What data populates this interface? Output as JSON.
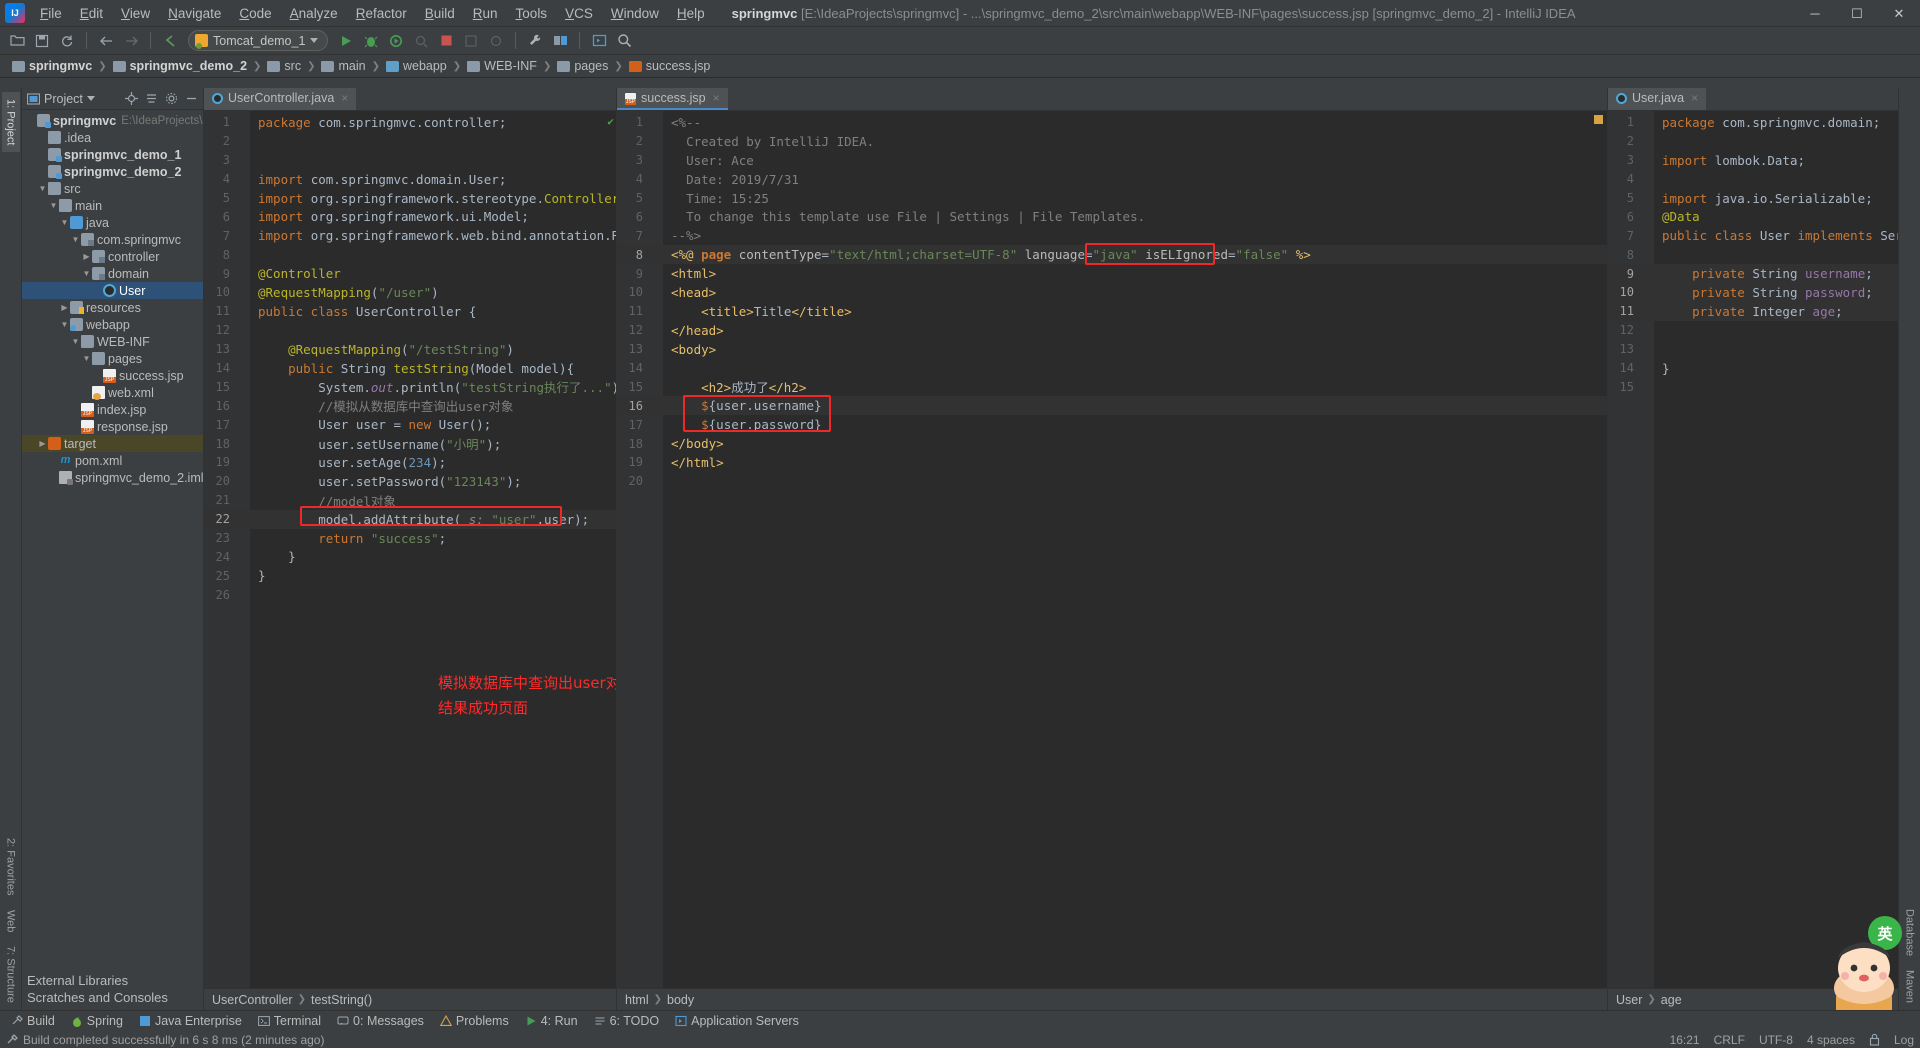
{
  "window": {
    "project_name": "springmvc",
    "title_path": "[E:\\IdeaProjects\\springmvc] - ...\\springmvc_demo_2\\src\\main\\webapp\\WEB-INF\\pages\\success.jsp [springmvc_demo_2] - IntelliJ IDEA",
    "minimize": "─",
    "maximize": "☐",
    "close": "✕"
  },
  "menubar": [
    {
      "label": "File"
    },
    {
      "label": "Edit"
    },
    {
      "label": "View"
    },
    {
      "label": "Navigate"
    },
    {
      "label": "Code"
    },
    {
      "label": "Analyze"
    },
    {
      "label": "Refactor"
    },
    {
      "label": "Build"
    },
    {
      "label": "Run"
    },
    {
      "label": "Tools"
    },
    {
      "label": "VCS"
    },
    {
      "label": "Window"
    },
    {
      "label": "Help"
    }
  ],
  "toolbar": {
    "run_config": "Tomcat_demo_1",
    "icons": [
      "open-folder-icon",
      "save-all-icon",
      "sync-icon",
      "back-arrow-icon",
      "forward-arrow-icon",
      "undo-icon",
      "run-icon",
      "debug-icon",
      "run-with-coverage-icon",
      "profile-icon",
      "stop-icon",
      "step-over-icon",
      "step-into-icon",
      "settings-wrench-icon",
      "project-structure-icon",
      "app-servers-icon",
      "search-everywhere-icon"
    ]
  },
  "breadcrumb": [
    {
      "label": "springmvc",
      "icon": "module-icon",
      "bold": true
    },
    {
      "label": "springmvc_demo_2",
      "icon": "module-icon",
      "bold": true
    },
    {
      "label": "src",
      "icon": "folder-icon",
      "bold": false
    },
    {
      "label": "main",
      "icon": "folder-icon",
      "bold": false
    },
    {
      "label": "webapp",
      "icon": "folder-web-icon",
      "bold": false
    },
    {
      "label": "WEB-INF",
      "icon": "folder-icon",
      "bold": false
    },
    {
      "label": "pages",
      "icon": "folder-icon",
      "bold": false
    },
    {
      "label": "success.jsp",
      "icon": "jsp-file-icon",
      "bold": false
    }
  ],
  "left_rail": [
    {
      "label": "1: Project",
      "icon": "project-icon",
      "active": true
    },
    {
      "label": "2: Favorites",
      "icon": "star-icon",
      "active": false
    },
    {
      "label": "Web",
      "icon": "web-icon",
      "active": false
    },
    {
      "label": "7: Structure",
      "icon": "structure-icon",
      "active": false
    }
  ],
  "right_rail": [
    {
      "label": "Database",
      "icon": "database-icon"
    },
    {
      "label": "Maven",
      "icon": "maven-icon"
    }
  ],
  "project_panel": {
    "title": "Project",
    "icons": [
      "locate-icon",
      "collapse-all-icon",
      "settings-gear-icon",
      "hide-icon"
    ],
    "tree": [
      {
        "indent": 0,
        "arrow": "",
        "icon": "module-icon",
        "label": "springmvc",
        "bold": true,
        "path": "E:\\IdeaProjects\\springmvc",
        "state": ""
      },
      {
        "indent": 1,
        "arrow": "",
        "icon": "folder-icon",
        "label": ".idea",
        "bold": false,
        "path": "",
        "state": ""
      },
      {
        "indent": 1,
        "arrow": "",
        "icon": "module-icon",
        "label": "springmvc_demo_1",
        "bold": true,
        "path": "",
        "state": ""
      },
      {
        "indent": 1,
        "arrow": "",
        "icon": "module-icon",
        "label": "springmvc_demo_2",
        "bold": true,
        "path": "",
        "state": ""
      },
      {
        "indent": 1,
        "arrow": "down",
        "icon": "folder-icon",
        "label": "src",
        "bold": false,
        "path": "",
        "state": ""
      },
      {
        "indent": 2,
        "arrow": "down",
        "icon": "folder-icon",
        "label": "main",
        "bold": false,
        "path": "",
        "state": ""
      },
      {
        "indent": 3,
        "arrow": "down",
        "icon": "folder-src-icon",
        "label": "java",
        "bold": false,
        "path": "",
        "state": ""
      },
      {
        "indent": 4,
        "arrow": "down",
        "icon": "folder-pkg-icon",
        "label": "com.springmvc",
        "bold": false,
        "path": "",
        "state": ""
      },
      {
        "indent": 5,
        "arrow": "right",
        "icon": "folder-pkg-icon",
        "label": "controller",
        "bold": false,
        "path": "",
        "state": ""
      },
      {
        "indent": 5,
        "arrow": "down",
        "icon": "folder-pkg-icon",
        "label": "domain",
        "bold": false,
        "path": "",
        "state": ""
      },
      {
        "indent": 6,
        "arrow": "",
        "icon": "class-icon",
        "label": "User",
        "bold": false,
        "path": "",
        "state": "sel"
      },
      {
        "indent": 3,
        "arrow": "right",
        "icon": "folder-res-icon",
        "label": "resources",
        "bold": false,
        "path": "",
        "state": ""
      },
      {
        "indent": 3,
        "arrow": "down",
        "icon": "folder-web-icon",
        "label": "webapp",
        "bold": false,
        "path": "",
        "state": ""
      },
      {
        "indent": 4,
        "arrow": "down",
        "icon": "folder-icon",
        "label": "WEB-INF",
        "bold": false,
        "path": "",
        "state": ""
      },
      {
        "indent": 5,
        "arrow": "down",
        "icon": "folder-icon",
        "label": "pages",
        "bold": false,
        "path": "",
        "state": ""
      },
      {
        "indent": 6,
        "arrow": "",
        "icon": "jsp-file-icon",
        "label": "success.jsp",
        "bold": false,
        "path": "",
        "state": ""
      },
      {
        "indent": 5,
        "arrow": "",
        "icon": "xml-file-icon",
        "label": "web.xml",
        "bold": false,
        "path": "",
        "state": ""
      },
      {
        "indent": 4,
        "arrow": "",
        "icon": "jsp-file-icon",
        "label": "index.jsp",
        "bold": false,
        "path": "",
        "state": ""
      },
      {
        "indent": 4,
        "arrow": "",
        "icon": "jsp-file-icon",
        "label": "response.jsp",
        "bold": false,
        "path": "",
        "state": ""
      },
      {
        "indent": 1,
        "arrow": "right",
        "icon": "folder-target-icon",
        "label": "target",
        "bold": false,
        "path": "",
        "state": "tgt"
      },
      {
        "indent": 2,
        "arrow": "",
        "icon": "maven-icon",
        "label": "pom.xml",
        "bold": false,
        "path": "",
        "state": ""
      },
      {
        "indent": 2,
        "arrow": "",
        "icon": "iml-icon",
        "label": "springmvc_demo_2.iml",
        "bold": false,
        "path": "",
        "state": ""
      }
    ],
    "external_libraries": "External Libraries",
    "scratches": "Scratches and Consoles"
  },
  "editor_left": {
    "tab": {
      "label": "UserController.java",
      "icon": "java-class-icon",
      "close": "×"
    },
    "breadcrumb": [
      "UserController",
      "testString()"
    ],
    "marker": "check-ok-icon",
    "lines": [
      {
        "n": 1,
        "html": "<span class='kw'>package</span> <span class='white'>com.springmvc.controller</span><span class='white'>;</span>"
      },
      {
        "n": 2,
        "html": ""
      },
      {
        "n": 3,
        "html": ""
      },
      {
        "n": 4,
        "html": "<span class='kw'>import</span> <span class='white'>com.springmvc.domain.User;</span>"
      },
      {
        "n": 5,
        "html": "<span class='kw'>import</span> <span class='white'>org.springframework.stereotype.</span><span class='ann'>Controller</span><span class='white'>;</span>"
      },
      {
        "n": 6,
        "html": "<span class='kw'>import</span> <span class='white'>org.springframework.ui.Model;</span>"
      },
      {
        "n": 7,
        "html": "<span class='kw'>import</span> <span class='white'>org.springframework.web.bind.annotation.RequestM</span>"
      },
      {
        "n": 8,
        "html": ""
      },
      {
        "n": 9,
        "html": "<span class='ann'>@Controller</span>"
      },
      {
        "n": 10,
        "html": "<span class='ann'>@RequestMapping</span><span class='white'>(</span><span class='str'>\"/user\"</span><span class='white'>)</span>"
      },
      {
        "n": 11,
        "html": "<span class='kw'>public class</span> <span class='white'>UserController {</span>"
      },
      {
        "n": 12,
        "html": ""
      },
      {
        "n": 13,
        "html": "    <span class='ann'>@RequestMapping</span><span class='white'>(</span><span class='str'>\"/testString\"</span><span class='white'>)</span>"
      },
      {
        "n": 14,
        "html": "    <span class='kw'>public</span> <span class='white'>String </span><span class='ann'>testString</span><span class='white'>(Model model){</span>"
      },
      {
        "n": 15,
        "html": "        <span class='white'>System.</span><span class='fld' style='font-style:italic'>out</span><span class='white'>.println(</span><span class='str'>\"testString执行了...\"</span><span class='white'>);</span>"
      },
      {
        "n": 16,
        "html": "        <span class='cmt'>//模拟从数据库中查询出user对象</span>"
      },
      {
        "n": 17,
        "html": "        <span class='white'>User user = </span><span class='kw'>new</span><span class='white'> User();</span>"
      },
      {
        "n": 18,
        "html": "        <span class='white'>user.setUsername(</span><span class='str'>\"小明\"</span><span class='white'>);</span>"
      },
      {
        "n": 19,
        "html": "        <span class='white'>user.setAge(</span><span class='num'>234</span><span class='white'>);</span>"
      },
      {
        "n": 20,
        "html": "        <span class='white'>user.setPassword(</span><span class='str'>\"123143\"</span><span class='white'>);</span>"
      },
      {
        "n": 21,
        "html": "        <span class='cmt'>//model对象</span>"
      },
      {
        "n": 22,
        "html": "        <span class='white'>model.addAttribute(</span> <span class='param'>s:</span> <span class='str'>\"user\"</span><span class='white'>,user);</span>"
      },
      {
        "n": 23,
        "html": "        <span class='kw'>return</span> <span class='str'>\"success\"</span><span class='white'>;</span>"
      },
      {
        "n": 24,
        "html": "    <span class='white'>}</span>"
      },
      {
        "n": 25,
        "html": "<span class='white'>}</span>"
      },
      {
        "n": 26,
        "html": ""
      }
    ],
    "annotation": "模拟数据库中查询出user对象，并把所取到的值转发到\n结果成功页面"
  },
  "editor_mid": {
    "tab": {
      "label": "success.jsp",
      "icon": "jsp-file-icon",
      "close": "×"
    },
    "breadcrumb": [
      "html",
      "body"
    ],
    "lines": [
      {
        "n": 1,
        "html": "<span class='cmt'>&lt;%--</span>"
      },
      {
        "n": 2,
        "html": "  <span class='cmt'>Created by IntelliJ IDEA.</span>"
      },
      {
        "n": 3,
        "html": "  <span class='cmt'>User: Ace</span>"
      },
      {
        "n": 4,
        "html": "  <span class='cmt'>Date: 2019/7/31</span>"
      },
      {
        "n": 5,
        "html": "  <span class='cmt'>Time: 15:25</span>"
      },
      {
        "n": 6,
        "html": "  <span class='cmt'>To change this template use File | Settings | File Templates.</span>"
      },
      {
        "n": 7,
        "html": "<span class='cmt'>--%&gt;</span>"
      },
      {
        "n": 8,
        "html": "<span class='tag'>&lt;%@</span> <span class='jspk'>page</span> <span class='attr'>contentType</span><span class='white'>=</span><span class='str'>\"text/html;charset=UTF-8\"</span> <span class='attr'>language</span><span class='white'>=</span><span class='str'>\"java\"</span> <span class='attr'>isELIgnored</span><span class='white'>=</span><span class='str'>\"false\"</span> <span class='tag'>%&gt;</span>"
      },
      {
        "n": 9,
        "html": "<span class='tag'>&lt;html&gt;</span>"
      },
      {
        "n": 10,
        "html": "<span class='tag'>&lt;head&gt;</span>"
      },
      {
        "n": 11,
        "html": "    <span class='tag'>&lt;title&gt;</span><span class='white'>Title</span><span class='tag'>&lt;/title&gt;</span>"
      },
      {
        "n": 12,
        "html": "<span class='tag'>&lt;/head&gt;</span>"
      },
      {
        "n": 13,
        "html": "<span class='tag'>&lt;body&gt;</span>"
      },
      {
        "n": 14,
        "html": ""
      },
      {
        "n": 15,
        "html": "    <span class='tag'>&lt;h2&gt;</span><span class='white'>成功了</span><span class='tag'>&lt;/h2&gt;</span>"
      },
      {
        "n": 16,
        "html": "    <span class='el'>$</span><span class='white'>{user.username}</span>"
      },
      {
        "n": 17,
        "html": "    <span class='el'>$</span><span class='white'>{user.password}</span>"
      },
      {
        "n": 18,
        "html": "<span class='tag'>&lt;/body&gt;</span>"
      },
      {
        "n": 19,
        "html": "<span class='tag'>&lt;/html&gt;</span>"
      },
      {
        "n": 20,
        "html": ""
      }
    ]
  },
  "editor_right": {
    "tab": {
      "label": "User.java",
      "icon": "java-class-icon",
      "close": "×"
    },
    "breadcrumb": [
      "User",
      "age"
    ],
    "lines": [
      {
        "n": 1,
        "html": "<span class='kw'>package</span> <span class='white'>com.springmvc.domain;</span>"
      },
      {
        "n": 2,
        "html": ""
      },
      {
        "n": 3,
        "html": "<span class='kw'>import</span> <span class='white'>lombok.Data;</span>"
      },
      {
        "n": 4,
        "html": ""
      },
      {
        "n": 5,
        "html": "<span class='kw'>import</span> <span class='white'>java.io.Serializable;</span>"
      },
      {
        "n": 6,
        "html": "<span class='ann'>@Data</span>"
      },
      {
        "n": 7,
        "html": "<span class='kw'>public class</span> <span class='white'>User </span><span class='kw'>implements</span><span class='white'> Serializab</span>"
      },
      {
        "n": 8,
        "html": ""
      },
      {
        "n": 9,
        "html": "    <span class='kw'>private</span> <span class='white'>String </span><span class='fld'>username</span><span class='white'>;</span>"
      },
      {
        "n": 10,
        "html": "    <span class='kw'>private</span> <span class='white'>String </span><span class='fld'>password</span><span class='white'>;</span>"
      },
      {
        "n": 11,
        "html": "    <span class='kw'>private</span> <span class='white'>Integer </span><span class='fld'>age</span><span class='white'>;</span>"
      },
      {
        "n": 12,
        "html": ""
      },
      {
        "n": 13,
        "html": ""
      },
      {
        "n": 14,
        "html": "<span class='white'>}</span>"
      },
      {
        "n": 15,
        "html": ""
      }
    ]
  },
  "bottom_tools": [
    {
      "label": "Build",
      "icon": "hammer-icon"
    },
    {
      "label": "Spring",
      "icon": "spring-leaf-icon"
    },
    {
      "label": "Java Enterprise",
      "icon": "java-ee-icon"
    },
    {
      "label": "Terminal",
      "icon": "terminal-icon"
    },
    {
      "label": "0: Messages",
      "icon": "messages-icon"
    },
    {
      "label": "Problems",
      "icon": "problems-icon"
    },
    {
      "label": "4: Run",
      "icon": "run-icon"
    },
    {
      "label": "6: TODO",
      "icon": "todo-icon"
    },
    {
      "label": "Application Servers",
      "icon": "app-servers-icon"
    }
  ],
  "status_bar": {
    "message": "Build completed successfully in 6 s 8 ms (2 minutes ago)",
    "time": "16:21",
    "line_separator": "CRLF",
    "encoding": "UTF-8",
    "indent": "4 spaces",
    "log_label": "Log",
    "lock_icon": "lock-icon"
  }
}
